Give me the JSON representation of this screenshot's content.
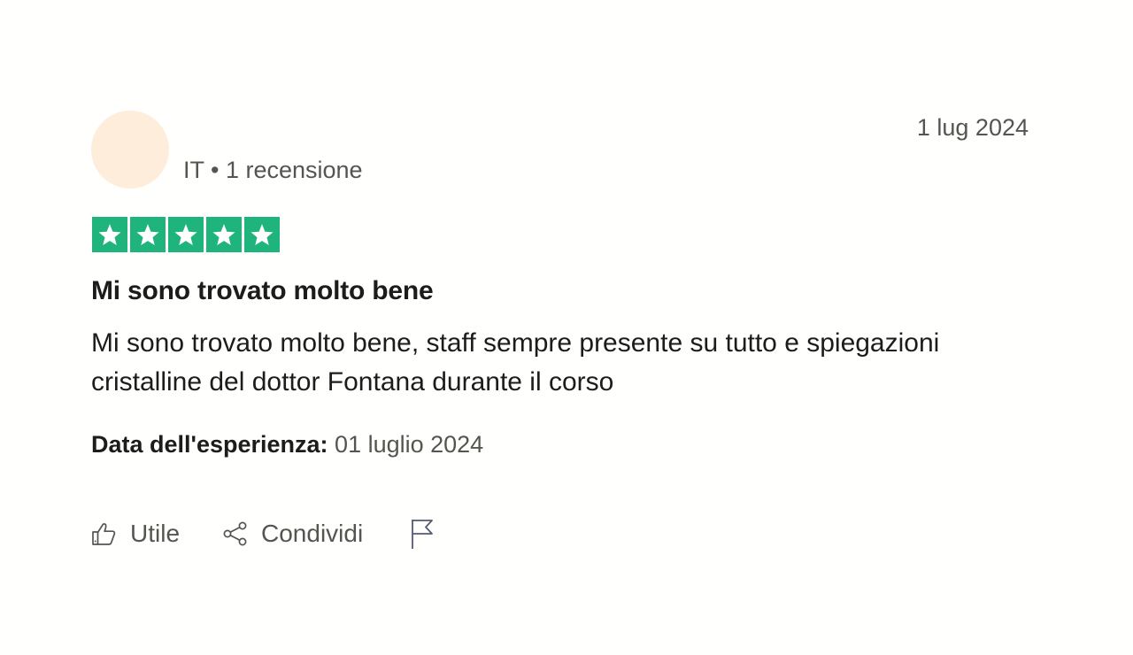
{
  "review": {
    "reviewer_meta": "IT • 1 recensione",
    "published_date": "1 lug 2024",
    "rating": 5,
    "rating_max": 5,
    "title": "Mi sono trovato molto bene",
    "body": "Mi sono trovato molto bene, staff sempre presente su tutto e spiegazioni cristalline del dottor Fontana durante il corso",
    "experience_label": "Data dell'esperienza:",
    "experience_date": "01 luglio 2024"
  },
  "actions": {
    "useful_label": "Utile",
    "share_label": "Condividi"
  },
  "colors": {
    "star_green": "#1fb47c",
    "avatar_bg": "#feeddb",
    "muted_text": "#555550"
  },
  "icons": {
    "useful": "thumbs-up-icon",
    "share": "share-icon",
    "report": "flag-icon",
    "star": "star-icon"
  }
}
